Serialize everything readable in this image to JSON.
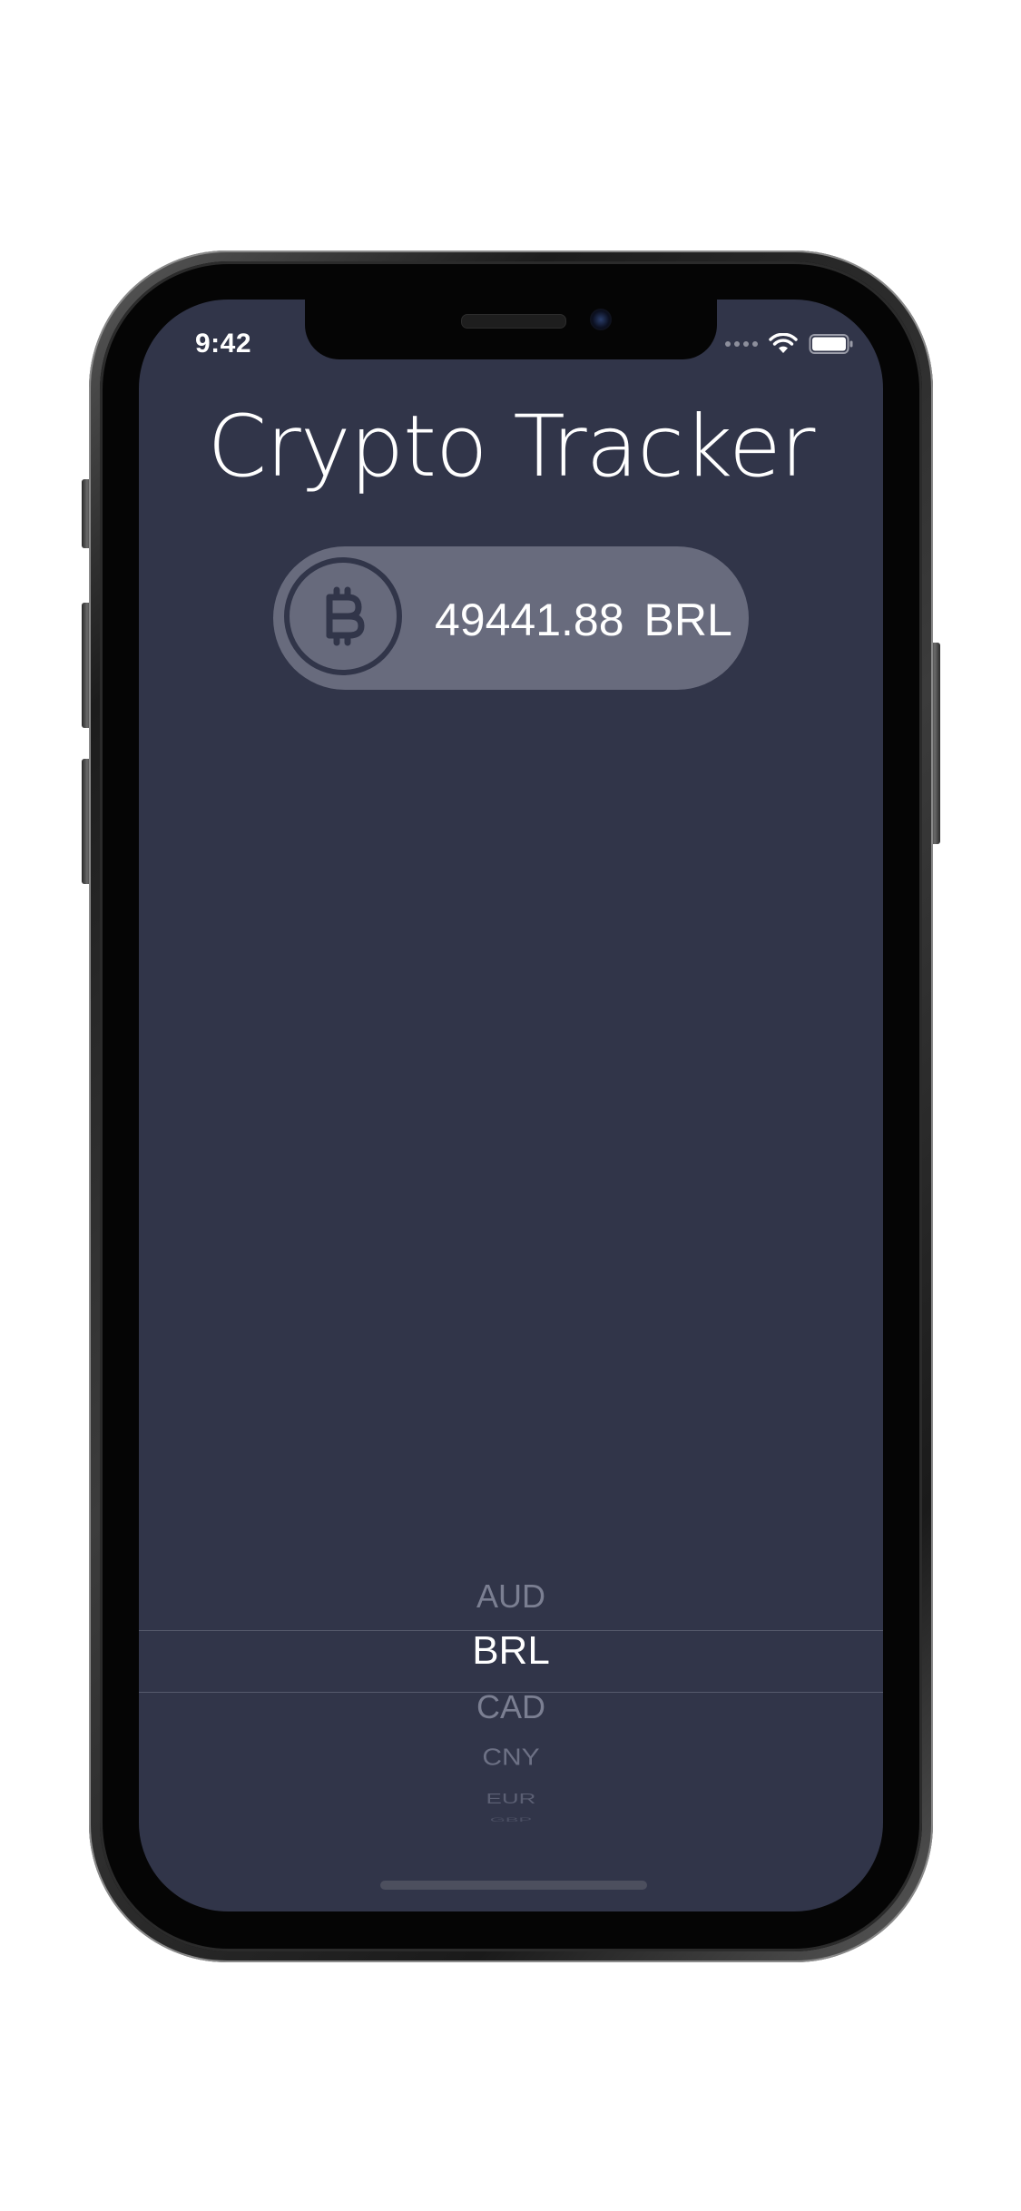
{
  "status_bar": {
    "time": "9:42"
  },
  "app": {
    "title": "Crypto Tracker",
    "coin_icon": "bitcoin-icon",
    "price": "49441.88",
    "currency": "BRL"
  },
  "currency_picker": {
    "options": [
      "AUD",
      "BRL",
      "CAD",
      "CNY",
      "EUR",
      "GBP"
    ],
    "selected": "BRL"
  },
  "colors": {
    "screen_background": "#313549",
    "pill_background": "#686b7d",
    "text_primary": "#ffffff",
    "picker_text_muted": "#7b7f92"
  }
}
